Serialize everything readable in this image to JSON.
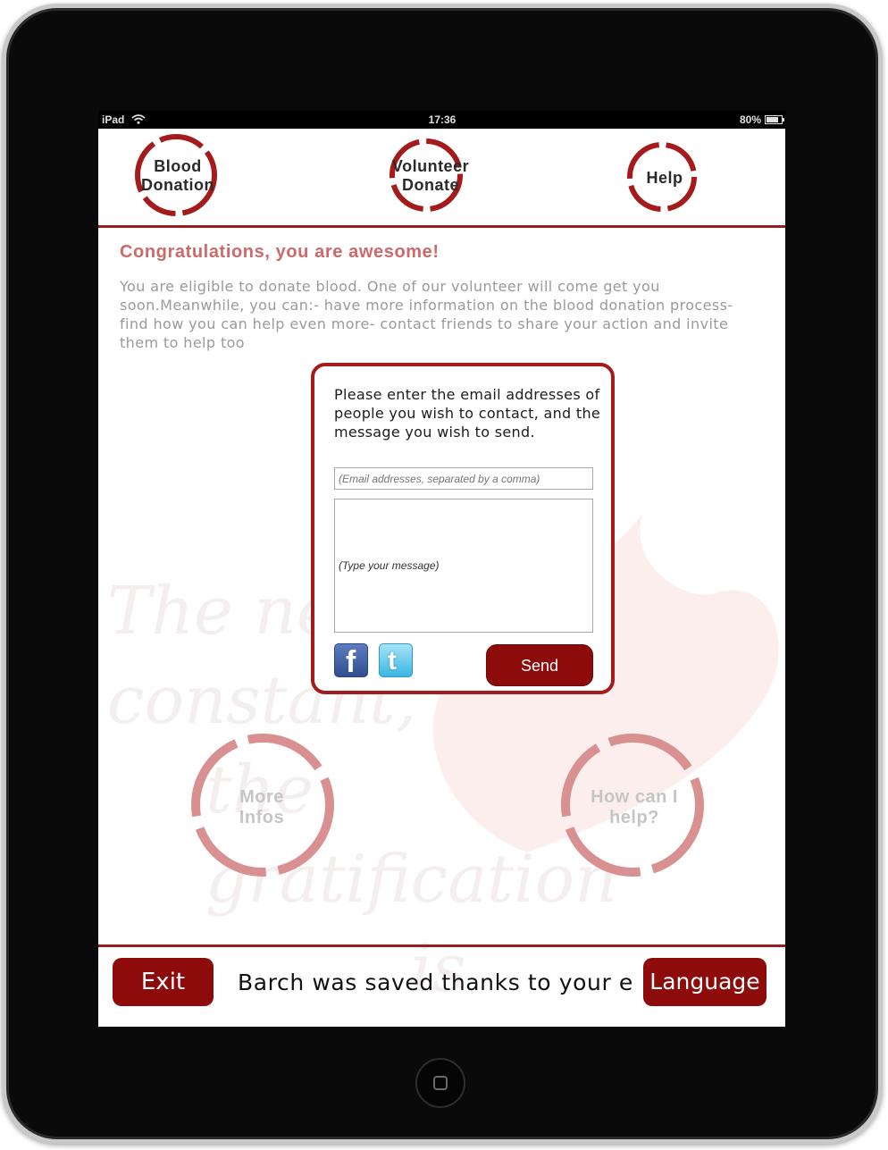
{
  "status_bar": {
    "device": "iPad",
    "time": "17:36",
    "battery": "80%"
  },
  "nav": {
    "blood_donation": [
      "Blood",
      "Donation"
    ],
    "volunteer_donate": [
      "Volunteer",
      "Donate"
    ],
    "help": "Help"
  },
  "main": {
    "heading": "Congratulations, you are awesome!",
    "intro": "You are eligible to donate blood. One of our volunteer will come get you soon.Meanwhile, you can:- have more information on the blood donation process- find how you can help even more- contact friends to share your action and invite them to help too"
  },
  "contact_form": {
    "prompt": "Please enter the email addresses of people you wish to contact, and the message you wish to send.",
    "email_placeholder": "(Email addresses, separated by a comma)",
    "message_placeholder": "(Type your message)",
    "send_label": "Send",
    "facebook_glyph": "f",
    "twitter_glyph": "t"
  },
  "actions": {
    "more_infos": [
      "More",
      "Infos"
    ],
    "how_can_i_help": [
      "How can I",
      "help?"
    ]
  },
  "watermark": [
    "The need is",
    "constant,",
    "the gratification",
    "is instant."
  ],
  "footer": {
    "exit_label": "Exit",
    "ticker": "Barch was saved thanks to your efforts",
    "language_label": "Language"
  },
  "colors": {
    "accent": "#8e0b0b",
    "ring": "#a51a1a",
    "heading": "#cc6a6a",
    "faded_ring": "#d99090"
  },
  "icons": [
    "wifi-icon",
    "battery-icon",
    "facebook-icon",
    "twitter-icon",
    "home-button-icon"
  ]
}
